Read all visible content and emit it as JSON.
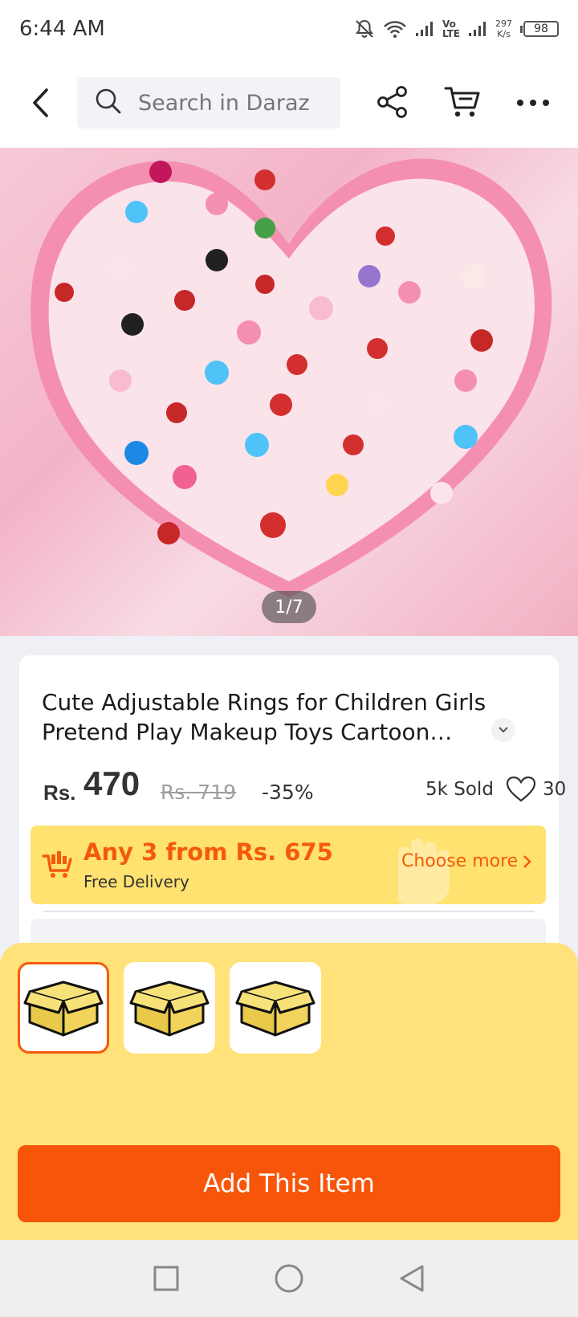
{
  "status_bar": {
    "time": "6:44 AM",
    "volte_top": "Vo",
    "volte_bottom": "LTE",
    "net_speed_value": "297",
    "net_speed_unit": "K/s",
    "battery": "98"
  },
  "top_nav": {
    "search_placeholder": "Search in Daraz",
    "icons": [
      "back-arrow-icon",
      "search-icon",
      "share-icon",
      "cart-icon",
      "more-icon"
    ]
  },
  "gallery": {
    "counter": "1/7",
    "current_image": 1,
    "total_images": 7
  },
  "product": {
    "title": "Cute Adjustable Rings for Children Girls Pretend Play Makeup Toys Cartoon Crystal",
    "currency": "Rs.",
    "price": "470",
    "original_price": "Rs. 719",
    "discount": "-35%",
    "sold": "5k Sold",
    "likes": "30"
  },
  "promo": {
    "title": "Any 3 from Rs. 675",
    "subtitle": "Free Delivery",
    "action": "Choose more"
  },
  "bottom_sheet": {
    "variants": [
      {
        "icon": "box-icon",
        "selected": true
      },
      {
        "icon": "box-icon",
        "selected": false
      },
      {
        "icon": "box-icon",
        "selected": false
      }
    ],
    "add_button": "Add This Item"
  },
  "colors": {
    "accent_orange": "#f7560a",
    "promo_yellow": "#ffe270",
    "sheet_yellow": "#ffe27a"
  },
  "android_nav": [
    "recents-square-icon",
    "home-circle-icon",
    "back-triangle-icon"
  ]
}
